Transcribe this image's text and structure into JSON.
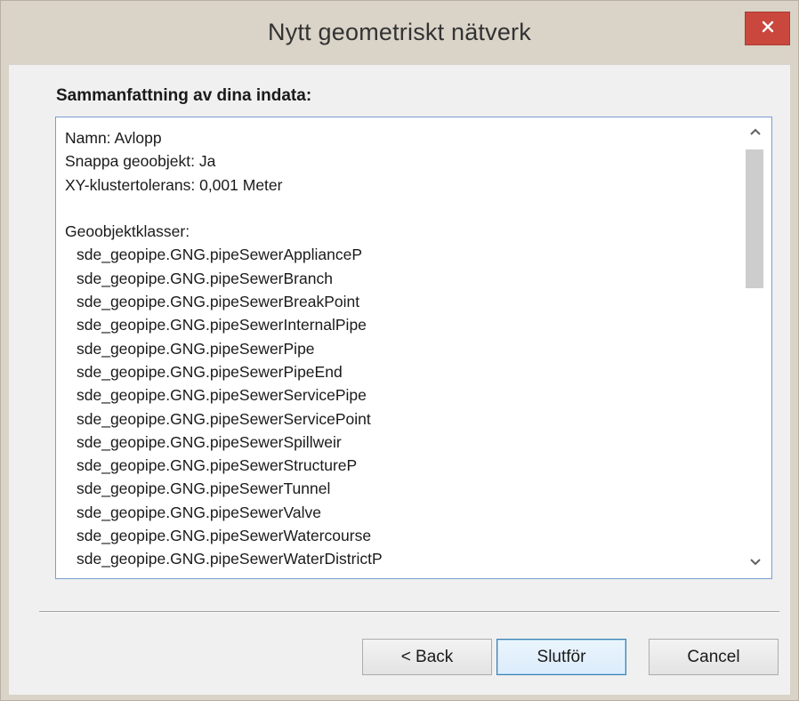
{
  "window": {
    "title": "Nytt geometriskt nätverk"
  },
  "summary": {
    "heading": "Sammanfattning av dina indata:",
    "lines": [
      {
        "text": "Namn: Avlopp",
        "indent": false
      },
      {
        "text": "Snappa geoobjekt: Ja",
        "indent": false
      },
      {
        "text": "XY-klustertolerans: 0,001 Meter",
        "indent": false
      },
      {
        "text": "",
        "indent": false
      },
      {
        "text": "Geoobjektklasser:",
        "indent": false
      },
      {
        "text": "sde_geopipe.GNG.pipeSewerApplianceP",
        "indent": true
      },
      {
        "text": "sde_geopipe.GNG.pipeSewerBranch",
        "indent": true
      },
      {
        "text": "sde_geopipe.GNG.pipeSewerBreakPoint",
        "indent": true
      },
      {
        "text": "sde_geopipe.GNG.pipeSewerInternalPipe",
        "indent": true
      },
      {
        "text": "sde_geopipe.GNG.pipeSewerPipe",
        "indent": true
      },
      {
        "text": "sde_geopipe.GNG.pipeSewerPipeEnd",
        "indent": true
      },
      {
        "text": "sde_geopipe.GNG.pipeSewerServicePipe",
        "indent": true
      },
      {
        "text": "sde_geopipe.GNG.pipeSewerServicePoint",
        "indent": true
      },
      {
        "text": "sde_geopipe.GNG.pipeSewerSpillweir",
        "indent": true
      },
      {
        "text": "sde_geopipe.GNG.pipeSewerStructureP",
        "indent": true
      },
      {
        "text": "sde_geopipe.GNG.pipeSewerTunnel",
        "indent": true
      },
      {
        "text": "sde_geopipe.GNG.pipeSewerValve",
        "indent": true
      },
      {
        "text": "sde_geopipe.GNG.pipeSewerWatercourse",
        "indent": true
      },
      {
        "text": "sde_geopipe.GNG.pipeSewerWaterDistrictP",
        "indent": true
      }
    ]
  },
  "scrollbar": {
    "up_icon": "chevron-up-icon",
    "down_icon": "chevron-down-icon"
  },
  "buttons": {
    "back_label": "< Back",
    "finish_label": "Slutför",
    "cancel_label": "Cancel"
  },
  "colors": {
    "close_button": "#c9473d",
    "frame": "#d9d3c8",
    "client": "#f0f0f0",
    "summary_border": "#7a9cd3",
    "default_button_border": "#3c7fb1"
  }
}
